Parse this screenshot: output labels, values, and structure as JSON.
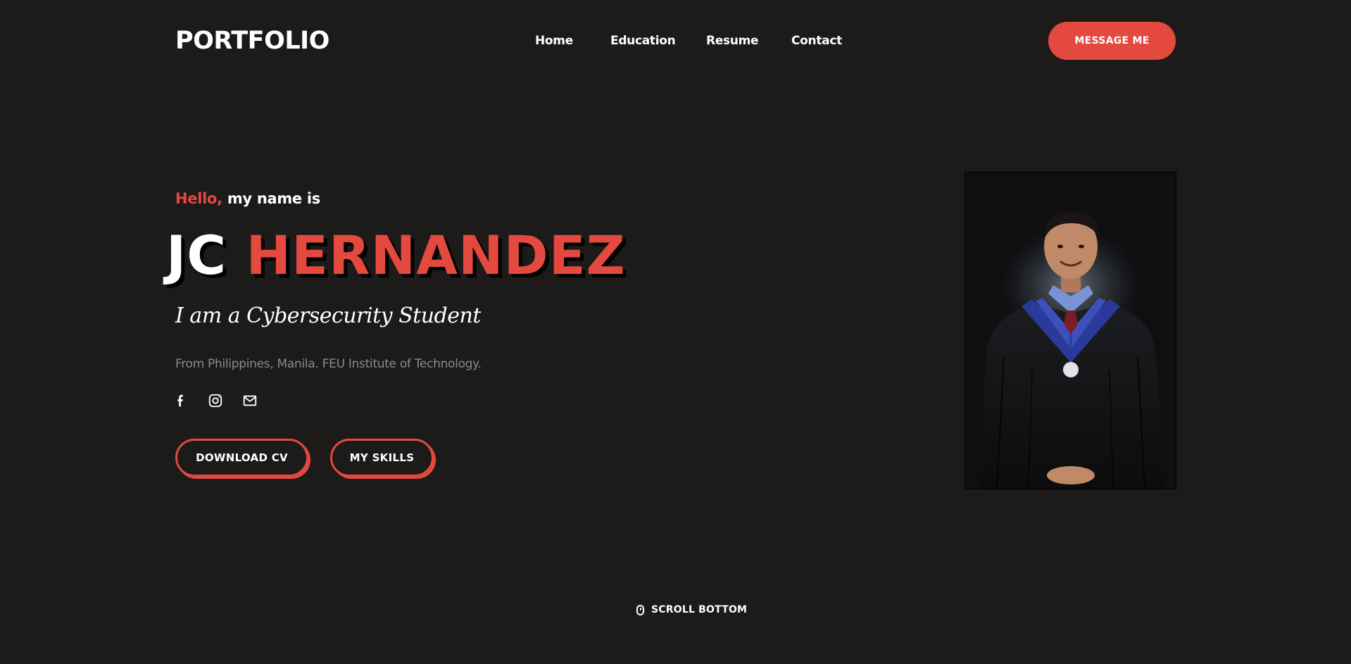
{
  "header": {
    "logo": "PORTFOLIO",
    "nav": [
      {
        "label": "Home"
      },
      {
        "label": "Education"
      },
      {
        "label": "Resume"
      },
      {
        "label": "Contact"
      }
    ],
    "cta_label": "MESSAGE ME"
  },
  "hero": {
    "greeting_accent": "Hello,",
    "greeting_rest": " my name is",
    "first_name": "JC",
    "last_name": "HERNANDEZ",
    "role": "I am a Cybersecurity Student",
    "location": "From Philippines, Manila. FEU Institute of Technology.",
    "socials": [
      {
        "icon": "facebook-icon"
      },
      {
        "icon": "instagram-icon"
      },
      {
        "icon": "mail-icon"
      }
    ],
    "buttons": {
      "download_cv": "DOWNLOAD CV",
      "my_skills": "MY SKILLS"
    },
    "photo_alt": "graduation portrait"
  },
  "scroll": {
    "label": "SCROLL BOTTOM",
    "icon": "mouse-icon"
  },
  "colors": {
    "background": "#1d1b1a",
    "accent": "#e4493f",
    "text": "#ffffff",
    "muted": "#8e8b88"
  }
}
